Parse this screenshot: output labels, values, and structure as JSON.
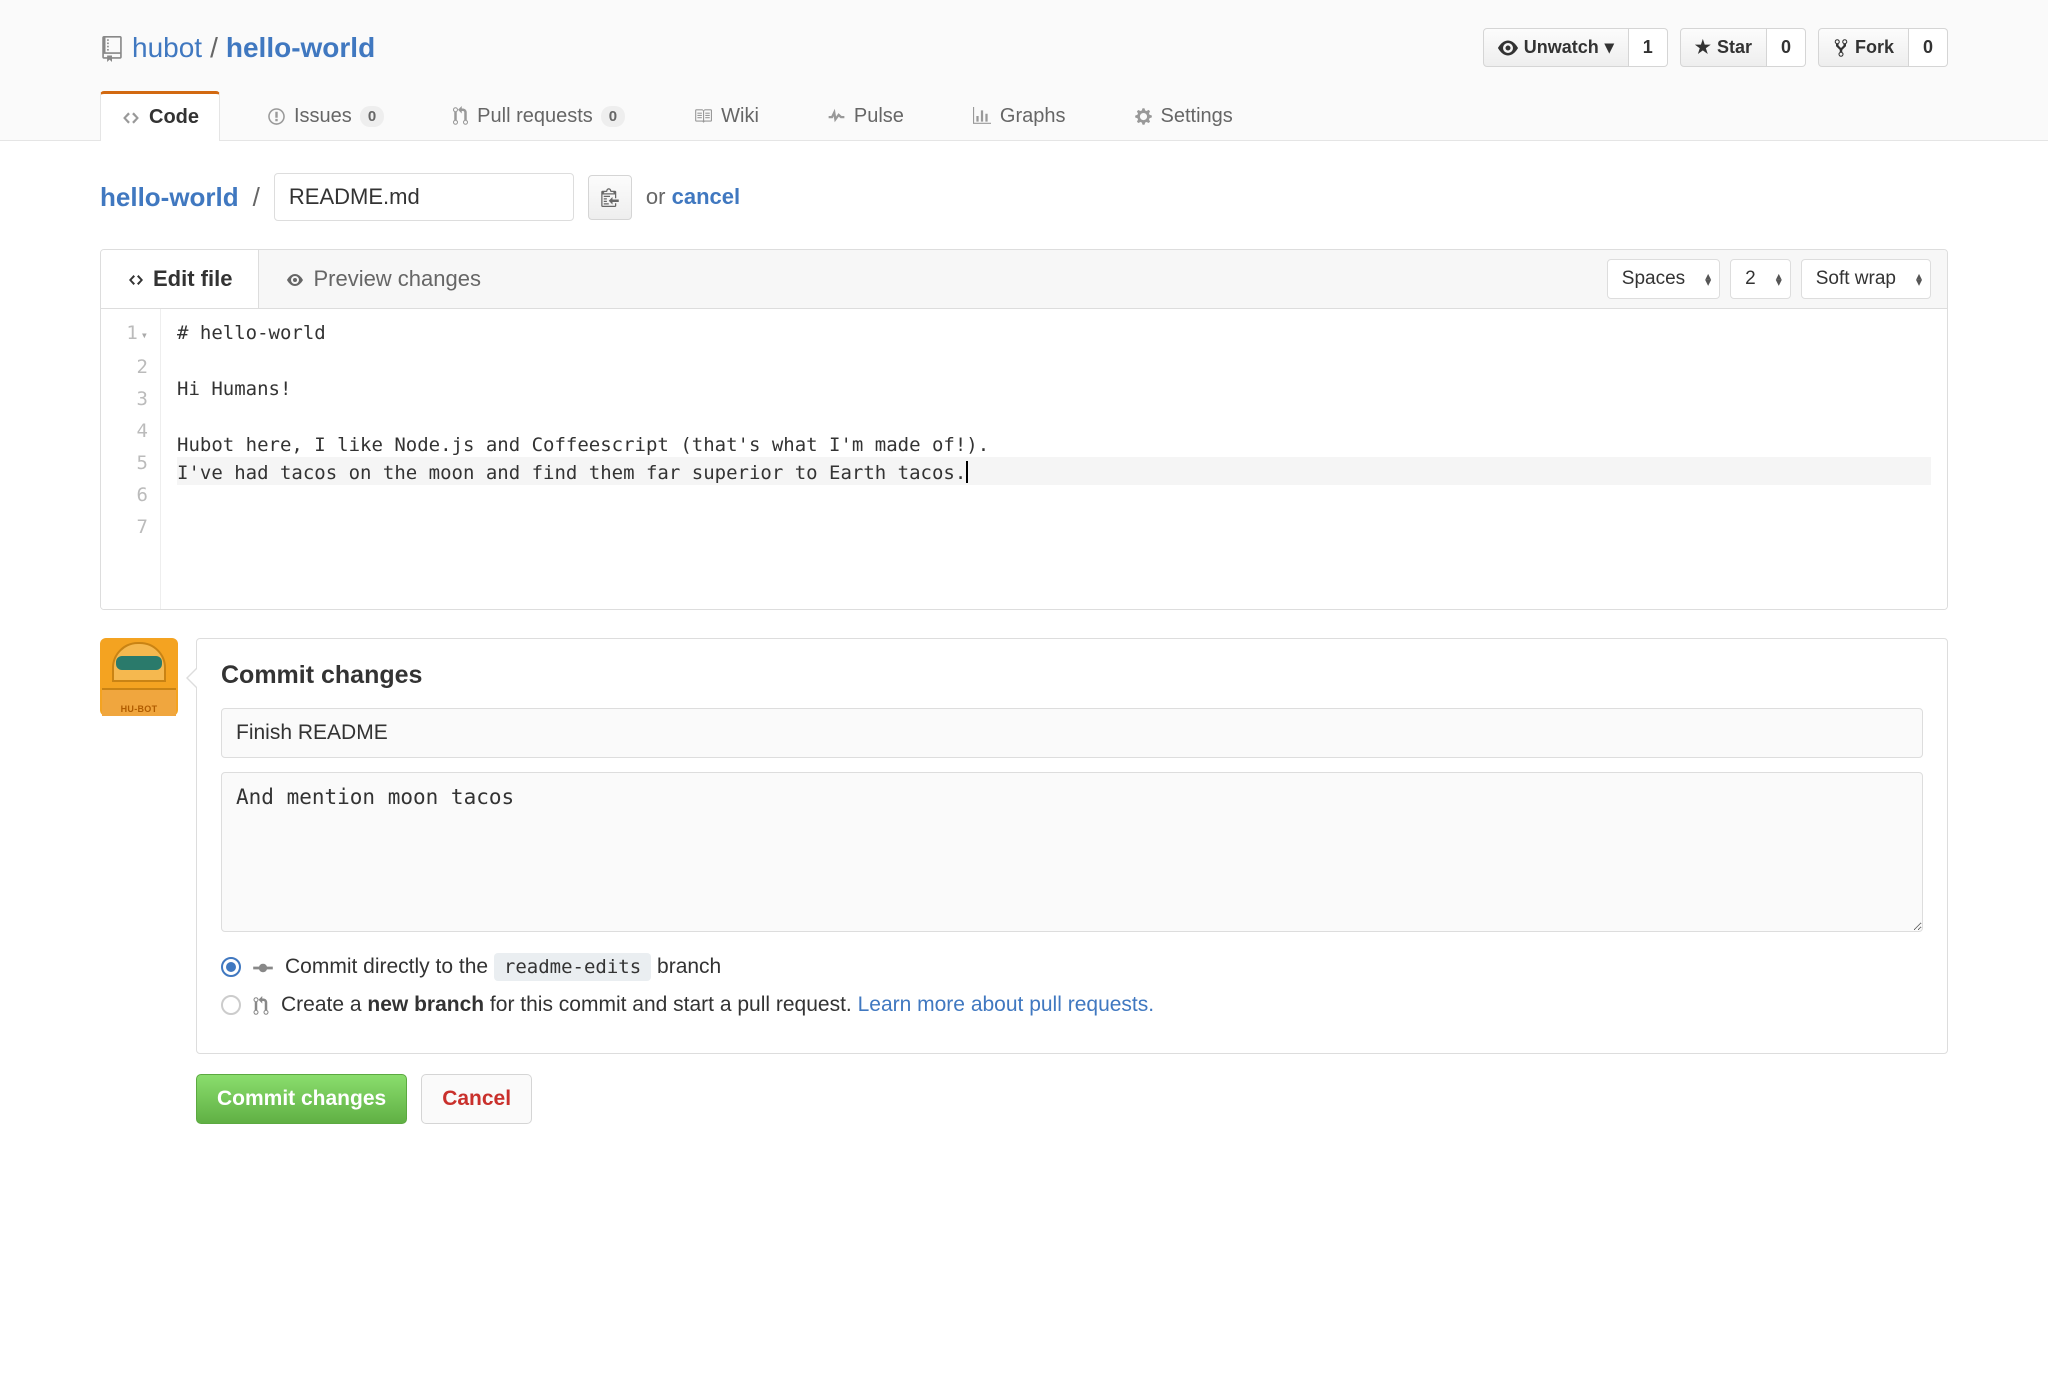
{
  "repo": {
    "owner": "hubot",
    "name": "hello-world"
  },
  "actions": {
    "unwatch": {
      "label": "Unwatch",
      "count": "1"
    },
    "star": {
      "label": "Star",
      "count": "0"
    },
    "fork": {
      "label": "Fork",
      "count": "0"
    }
  },
  "tabs": {
    "code": "Code",
    "issues": {
      "label": "Issues",
      "count": "0"
    },
    "pulls": {
      "label": "Pull requests",
      "count": "0"
    },
    "wiki": "Wiki",
    "pulse": "Pulse",
    "graphs": "Graphs",
    "settings": "Settings"
  },
  "breadcrumb": {
    "root": "hello-world",
    "filename": "README.md",
    "or": "or",
    "cancel": "cancel"
  },
  "editor": {
    "tab_edit": "Edit file",
    "tab_preview": "Preview changes",
    "indent_mode": "Spaces",
    "indent_size": "2",
    "wrap_mode": "Soft wrap",
    "lines": [
      "# hello-world",
      "",
      "Hi Humans!",
      "",
      "Hubot here, I like Node.js and Coffeescript (that's what I'm made of!).",
      "I've had tacos on the moon and find them far superior to Earth tacos.",
      ""
    ]
  },
  "avatar_label": "HU-BOT",
  "commit": {
    "heading": "Commit changes",
    "summary": "Finish README",
    "description": "And mention moon tacos",
    "opt_direct_pre": "Commit directly to the ",
    "opt_direct_branch": "readme-edits",
    "opt_direct_post": " branch",
    "opt_new_pre": "Create a ",
    "opt_new_strong": "new branch",
    "opt_new_post": " for this commit and start a pull request. ",
    "opt_new_link": "Learn more about pull requests.",
    "btn_commit": "Commit changes",
    "btn_cancel": "Cancel"
  }
}
